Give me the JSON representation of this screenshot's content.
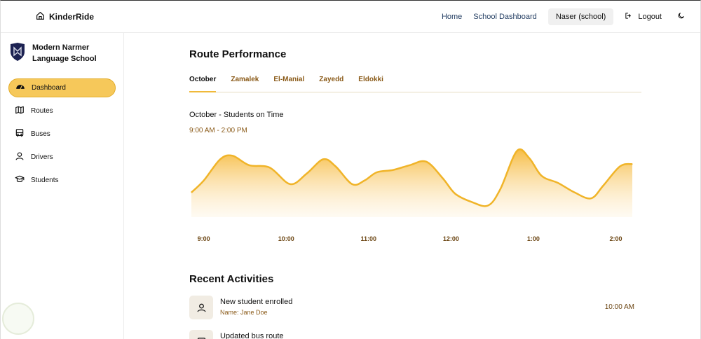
{
  "brand": {
    "name": "KinderRide",
    "icon": "home-icon"
  },
  "nav": {
    "home": "Home",
    "dashboard": "School Dashboard",
    "user": "Naser (school)",
    "logout": "Logout",
    "theme_icon": "moon-icon"
  },
  "sidebar": {
    "school_name": "Modern Narmer Language School",
    "items": [
      {
        "label": "Dashboard",
        "icon": "dashboard-icon",
        "active": true
      },
      {
        "label": "Routes",
        "icon": "map-icon"
      },
      {
        "label": "Buses",
        "icon": "bus-icon"
      },
      {
        "label": "Drivers",
        "icon": "user-icon"
      },
      {
        "label": "Students",
        "icon": "graduation-cap-icon"
      }
    ]
  },
  "main": {
    "title": "Route Performance",
    "tabs": [
      "October",
      "Zamalek",
      "El-Manial",
      "Zayedd",
      "Eldokki"
    ],
    "chart_title": "October - Students on Time",
    "chart_subtitle": "9:00 AM - 2:00 PM",
    "recent_title": "Recent Activities",
    "activities": [
      {
        "title": "New student enrolled",
        "detail": "Name: Jane Doe",
        "time": "10:00 AM",
        "icon": "user-icon"
      },
      {
        "title": "Updated bus route",
        "detail": "",
        "time": "",
        "icon": "bus-icon"
      }
    ]
  },
  "colors": {
    "accent": "#f6c85a",
    "accent_line": "#f0b429",
    "brown_text": "#8a5a18"
  },
  "chart_data": {
    "type": "area",
    "title": "October - Students on Time",
    "subtitle": "9:00 AM - 2:00 PM",
    "tick_labels": [
      "9:00",
      "10:00",
      "11:00",
      "12:00",
      "1:00",
      "2:00"
    ],
    "x": [
      8.85,
      9.0,
      9.2,
      9.35,
      9.55,
      9.8,
      10.05,
      10.25,
      10.45,
      10.6,
      10.8,
      10.95,
      11.1,
      11.3,
      11.5,
      11.7,
      11.9,
      12.05,
      12.25,
      12.45,
      12.6,
      12.8,
      12.95,
      13.1,
      13.3,
      13.5,
      13.7,
      13.85,
      14.05,
      14.2
    ],
    "y": [
      62,
      72,
      90,
      93,
      85,
      83,
      69,
      78,
      90,
      84,
      69,
      72,
      79,
      81,
      85,
      88,
      74,
      61,
      54,
      51,
      65,
      97,
      91,
      76,
      70,
      62,
      57,
      68,
      84,
      86
    ],
    "ylim": [
      40,
      105
    ],
    "xlim": [
      8.85,
      14.2
    ],
    "grid": false,
    "legend": "none"
  }
}
